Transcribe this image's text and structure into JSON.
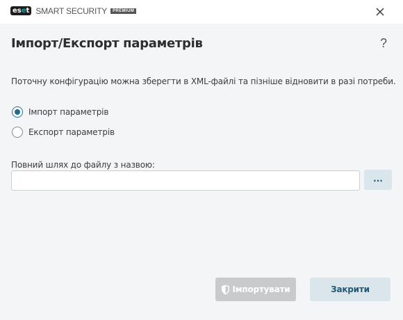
{
  "app": {
    "logo_text": "eset",
    "product_name": "SMART SECURITY",
    "edition_badge": "PREMIUM"
  },
  "window": {
    "close_icon": "close-icon"
  },
  "dialog": {
    "title": "Імпорт/Експорт параметрів",
    "help_label": "?",
    "description": "Поточну конфігурацію можна зберегти в XML-файлі та пізніше відновити в разі потреби.",
    "options": [
      {
        "label": "Імпорт параметрів",
        "selected": true
      },
      {
        "label": "Експорт параметрів",
        "selected": false
      }
    ],
    "path_label": "Повний шлях до файлу з назвою:",
    "path_value": "",
    "browse_label": "...",
    "import_button": {
      "label": "Імпортувати",
      "icon": "shield-icon",
      "enabled": false
    },
    "close_button": {
      "label": "Закрити"
    }
  },
  "colors": {
    "accent": "#1f6e92",
    "background": "#f4f5f6",
    "disabled_button": "#c9cacb",
    "secondary_button": "#dbe5ec"
  }
}
